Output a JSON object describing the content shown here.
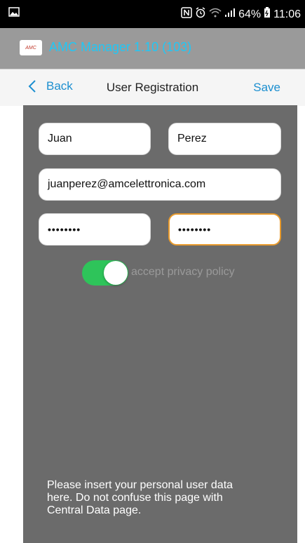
{
  "status_bar": {
    "battery": "64%",
    "time": "11:06"
  },
  "app_bar": {
    "logo_text": "AMC",
    "title": "AMC Manager 1.10 (103)",
    "title_color": "#21c7f5"
  },
  "nav": {
    "back_label": "Back",
    "title": "User Registration",
    "save_label": "Save"
  },
  "form": {
    "first_name": "Juan",
    "last_name": "Perez",
    "email": "juanperez@amcelettronica.com",
    "password": "••••••••",
    "password_confirm": "••••••••",
    "privacy_toggle_on": true,
    "privacy_label": "accept privacy policy",
    "toggle_color": "#2ec45a",
    "focus_color": "#e89a2c"
  },
  "info_text": "Please insert your personal user data here. Do not confuse this page with Central Data page."
}
